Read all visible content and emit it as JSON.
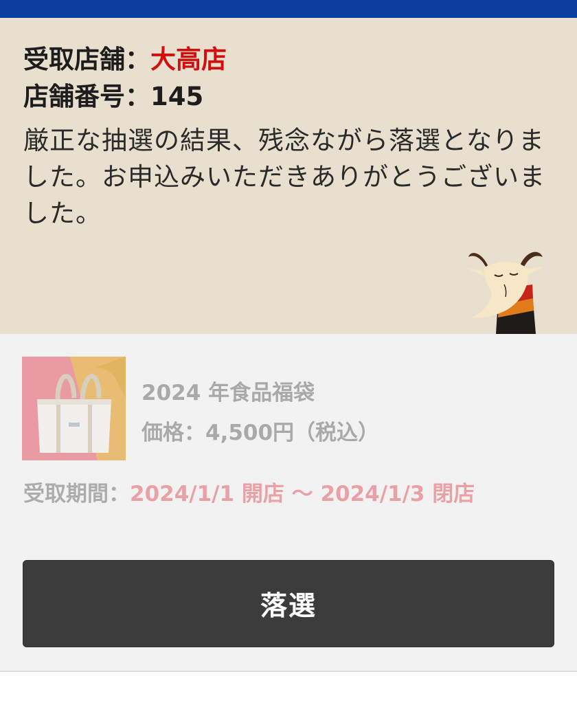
{
  "store": {
    "label": "受取店舗：",
    "name": "大高店",
    "number_label": "店舗番号：",
    "number": "145"
  },
  "message": "厳正な抽選の結果、残念ながら落選となりました。お申込みいただきありがとうございました。",
  "product": {
    "name": "2024 年食品福袋",
    "price": "価格：4,500円（税込）"
  },
  "period": {
    "label": "受取期間：",
    "value": "2024/1/1 開店 〜 2024/1/3 閉店"
  },
  "result_button": {
    "label": "落選"
  },
  "colors": {
    "top_bar": "#0a3d9e",
    "panel_bg": "#e8dfcf",
    "store_name": "#d20f0f",
    "period_value": "#eaa1a6",
    "button_bg": "#3c3c3c"
  },
  "icons": {
    "mascot": "goat-mascot-icon",
    "product_image": "tote-bag-image"
  }
}
